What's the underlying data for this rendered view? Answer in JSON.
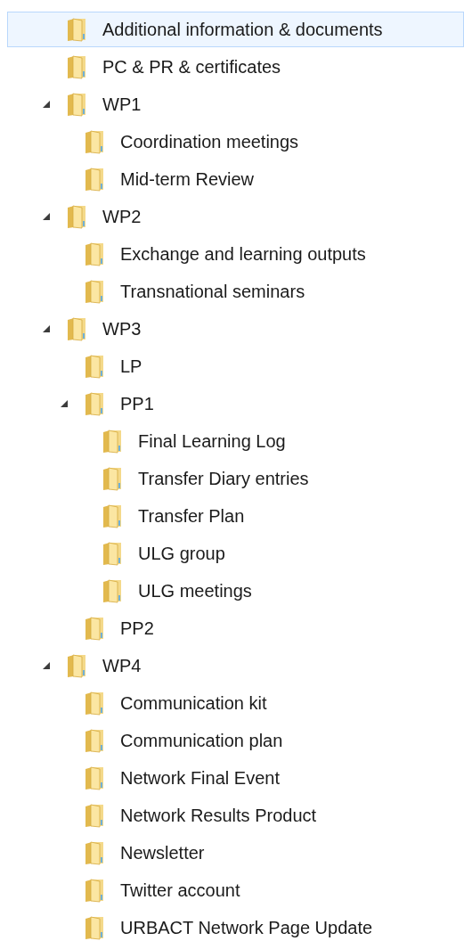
{
  "folder_tree": [
    {
      "name": "Additional information & documents",
      "selected": true
    },
    {
      "name": "PC & PR & certificates",
      "selected": false
    },
    {
      "name": "WP1",
      "selected": false,
      "expanded": true,
      "children": [
        {
          "name": "Coordination meetings",
          "selected": false
        },
        {
          "name": "Mid-term Review",
          "selected": false
        }
      ]
    },
    {
      "name": "WP2",
      "selected": false,
      "expanded": true,
      "children": [
        {
          "name": "Exchange and learning outputs",
          "selected": false
        },
        {
          "name": "Transnational seminars",
          "selected": false
        }
      ]
    },
    {
      "name": "WP3",
      "selected": false,
      "expanded": true,
      "children": [
        {
          "name": "LP",
          "selected": false
        },
        {
          "name": "PP1",
          "selected": false,
          "expanded": true,
          "children": [
            {
              "name": "Final Learning Log",
              "selected": false
            },
            {
              "name": "Transfer Diary entries",
              "selected": false
            },
            {
              "name": "Transfer Plan",
              "selected": false
            },
            {
              "name": "ULG group",
              "selected": false
            },
            {
              "name": "ULG meetings",
              "selected": false
            }
          ]
        },
        {
          "name": "PP2",
          "selected": false
        }
      ]
    },
    {
      "name": "WP4",
      "selected": false,
      "expanded": true,
      "children": [
        {
          "name": "Communication kit",
          "selected": false
        },
        {
          "name": "Communication plan",
          "selected": false
        },
        {
          "name": "Network Final Event",
          "selected": false
        },
        {
          "name": "Network Results Product",
          "selected": false
        },
        {
          "name": "Newsletter",
          "selected": false
        },
        {
          "name": "Twitter account",
          "selected": false
        },
        {
          "name": "URBACT Network Page Update",
          "selected": false
        }
      ]
    }
  ]
}
